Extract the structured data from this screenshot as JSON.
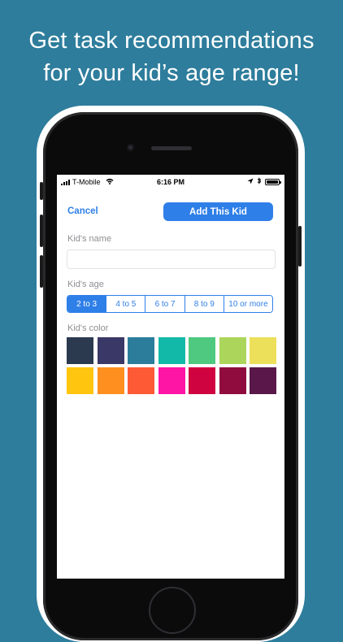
{
  "headline": {
    "line1": "Get task recommendations",
    "line2": "for your kid’s age range!"
  },
  "status_bar": {
    "carrier": "T-Mobile",
    "time": "6:16 PM",
    "icons": [
      "signal-bars-icon",
      "wifi-icon",
      "location-arrow-icon",
      "bluetooth-icon",
      "battery-icon"
    ]
  },
  "nav": {
    "cancel_label": "Cancel",
    "add_label": "Add This Kid"
  },
  "form": {
    "name_label": "Kid's name",
    "name_value": "",
    "name_placeholder": "",
    "age_label": "Kid's age",
    "age_options": [
      "2 to 3",
      "4 to 5",
      "6 to 7",
      "8 to 9",
      "10 or more"
    ],
    "age_selected": "2 to 3",
    "color_label": "Kid's color",
    "colors": [
      "#2b3a4f",
      "#3a3866",
      "#2b7d9b",
      "#13b9a8",
      "#4ec97f",
      "#acd55b",
      "#ece05a",
      "#ffc50f",
      "#ff901f",
      "#ff5a36",
      "#ff15a5",
      "#cf033f",
      "#900c3f",
      "#591849"
    ]
  },
  "theme": {
    "background": "#2e7d9c",
    "accent": "#2f7fe8"
  }
}
